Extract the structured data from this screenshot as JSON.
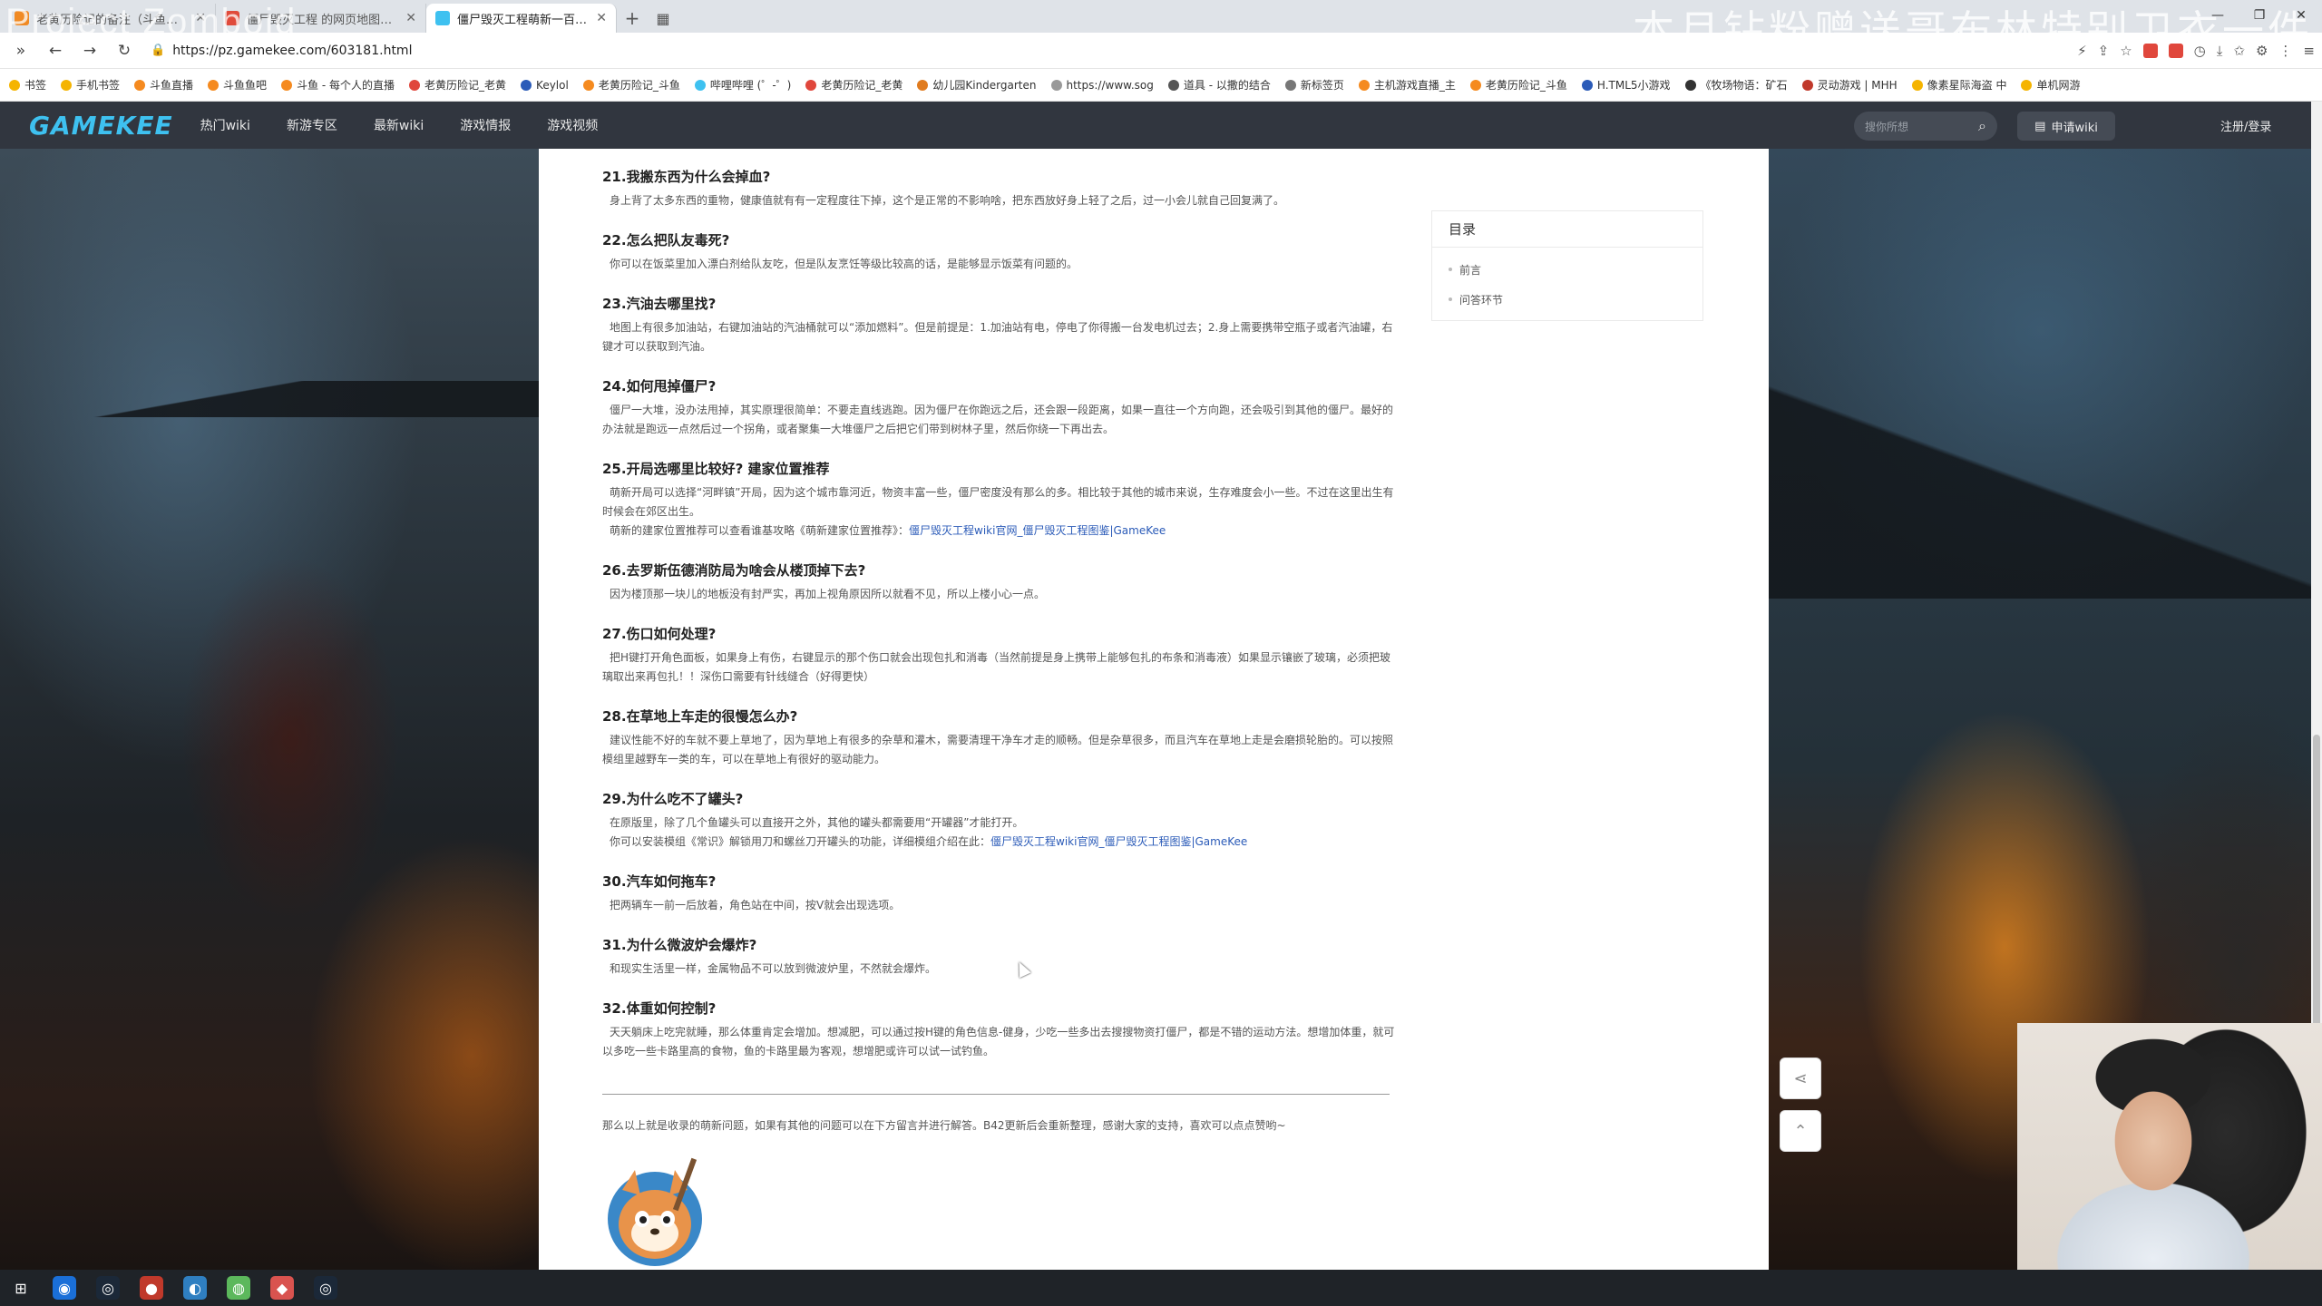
{
  "browser": {
    "tabs": [
      {
        "title": "老黄历险记的备注（斗鱼直播",
        "favicon_color": "#f08a24"
      },
      {
        "title": "僵尸毁灭工程 的网页地图和中文",
        "favicon_color": "#e04b3b"
      },
      {
        "title": "僵尸毁灭工程萌新一百问_僵尸",
        "favicon_color": "#3ec1f0",
        "active": true
      }
    ],
    "new_tab": "+",
    "url": "https://pz.gamekee.com/603181.html",
    "overlay_left": "Project Zomboid",
    "overlay_right": "本月钻粉赠送哥布林特别卫衣一件",
    "bookmarks": [
      "书签",
      "手机书签",
      "斗鱼直播",
      "斗鱼鱼吧",
      "斗鱼 - 每个人的直播",
      "老黄历险记_老黄",
      "Keylol",
      "老黄历险记_斗鱼",
      "哔哩哔哩 (゜-゜)",
      "老黄历险记_老黄",
      "幼儿园Kindergarten",
      "https://www.sog",
      "道具 - 以撒的结合",
      "新标签页",
      "主机游戏直播_主",
      "老黄历险记_斗鱼",
      "H.TML5小游戏",
      "《牧场物语：矿石",
      "灵动游戏 | MHH",
      "像素星际海盗 中",
      "单机网游"
    ]
  },
  "site": {
    "logo": "GAMEKEE",
    "nav": [
      "热门wiki",
      "新游专区",
      "最新wiki",
      "游戏情报",
      "游戏视频"
    ],
    "search_placeholder": "搜你所想",
    "apply_label": "申请wiki",
    "login_label": "注册/登录"
  },
  "toc": {
    "title": "目录",
    "items": [
      "前言",
      "问答环节"
    ]
  },
  "questions": [
    {
      "title": "21.我搬东西为什么会掉血?",
      "body": "身上背了太多东西的重物，健康值就有有一定程度往下掉，这个是正常的不影响啥，把东西放好身上轻了之后，过一小会儿就自己回复满了。"
    },
    {
      "title": "22.怎么把队友毒死?",
      "body": "你可以在饭菜里加入漂白剂给队友吃，但是队友烹饪等级比较高的话，是能够显示饭菜有问题的。"
    },
    {
      "title": "23.汽油去哪里找?",
      "body": "地图上有很多加油站，右键加油站的汽油桶就可以“添加燃料”。但是前提是：1.加油站有电，停电了你得搬一台发电机过去；2.身上需要携带空瓶子或者汽油罐，右键才可以获取到汽油。"
    },
    {
      "title": "24.如何甩掉僵尸?",
      "body": "僵尸一大堆，没办法甩掉，其实原理很简单：不要走直线逃跑。因为僵尸在你跑远之后，还会跟一段距离，如果一直往一个方向跑，还会吸引到其他的僵尸。最好的办法就是跑远一点然后过一个拐角，或者聚集一大堆僵尸之后把它们带到树林子里，然后你绕一下再出去。"
    },
    {
      "title": "25.开局选哪里比较好? 建家位置推荐",
      "body": "萌新开局可以选择“河畔镇”开局，因为这个城市靠河近，物资丰富一些，僵尸密度没有那么的多。相比较于其他的城市来说，生存难度会小一些。不过在这里出生有时候会在郊区出生。",
      "body2": "萌新的建家位置推荐可以查看谁基攻略《萌新建家位置推荐》：",
      "link": "僵尸毁灭工程wiki官网_僵尸毁灭工程图鉴|GameKee"
    },
    {
      "title": "26.去罗斯伍德消防局为啥会从楼顶掉下去?",
      "body": "因为楼顶那一块儿的地板没有封严实，再加上视角原因所以就看不见，所以上楼小心一点。"
    },
    {
      "title": "27.伤口如何处理?",
      "body": "把H键打开角色面板，如果身上有伤，右键显示的那个伤口就会出现包扎和消毒（当然前提是身上携带上能够包扎的布条和消毒液）如果显示镶嵌了玻璃，必须把玻璃取出来再包扎！！深伤口需要有针线缝合（好得更快）"
    },
    {
      "title": "28.在草地上车走的很慢怎么办?",
      "body": "建议性能不好的车就不要上草地了，因为草地上有很多的杂草和灌木，需要清理干净车才走的顺畅。但是杂草很多，而且汽车在草地上走是会磨损轮胎的。可以按照模组里越野车一类的车，可以在草地上有很好的驱动能力。"
    },
    {
      "title": "29.为什么吃不了罐头?",
      "body": "在原版里，除了几个鱼罐头可以直接开之外，其他的罐头都需要用“开罐器”才能打开。",
      "body2": "你可以安装模组《常识》解锁用刀和螺丝刀开罐头的功能，详细模组介绍在此：",
      "link": "僵尸毁灭工程wiki官网_僵尸毁灭工程图鉴|GameKee"
    },
    {
      "title": "30.汽车如何拖车?",
      "body": "把两辆车一前一后放着，角色站在中间，按V就会出现选项。"
    },
    {
      "title": "31.为什么微波炉会爆炸?",
      "body": "和现实生活里一样，金属物品不可以放到微波炉里，不然就会爆炸。"
    },
    {
      "title": "32.体重如何控制?",
      "body": "天天躺床上吃完就睡，那么体重肯定会增加。想减肥，可以通过按H键的角色信息-健身，少吃一些多出去搜搜物资打僵尸，都是不错的运动方法。想增加体重，就可以多吃一些卡路里高的食物，鱼的卡路里最为客观，想增肥或许可以试一试钓鱼。"
    }
  ],
  "outro": "那么以上就是收录的萌新问题，如果有其他的问题可以在下方留言并进行解答。B42更新后会重新整理，感谢大家的支持，喜欢可以点点赞哟~",
  "float_buttons": {
    "share": "share-icon",
    "top": "back-to-top-icon"
  }
}
